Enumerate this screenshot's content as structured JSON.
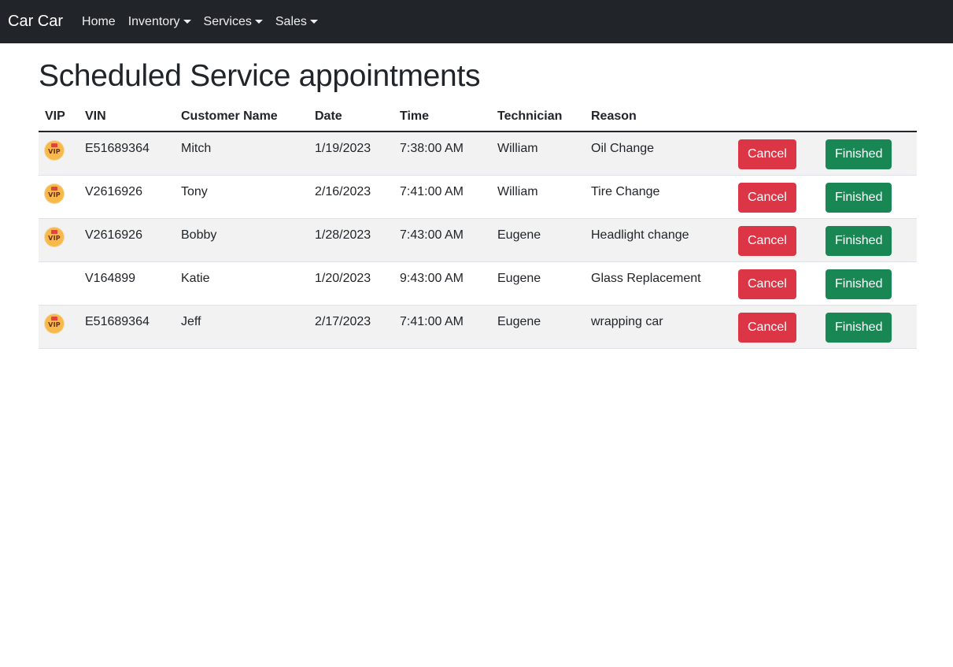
{
  "navbar": {
    "brand": "Car Car",
    "links": [
      {
        "label": "Home",
        "dropdown": false
      },
      {
        "label": "Inventory",
        "dropdown": true
      },
      {
        "label": "Services",
        "dropdown": true
      },
      {
        "label": "Sales",
        "dropdown": true
      }
    ]
  },
  "page": {
    "title": "Scheduled Service appointments"
  },
  "table": {
    "headers": [
      "VIP",
      "VIN",
      "Customer Name",
      "Date",
      "Time",
      "Technician",
      "Reason",
      "",
      ""
    ],
    "vip_icon_text": "VIP",
    "cancel_label": "Cancel",
    "finished_label": "Finished",
    "rows": [
      {
        "vip": true,
        "vin": "E51689364",
        "customer": "Mitch",
        "date": "1/19/2023",
        "time": "7:38:00 AM",
        "technician": "William",
        "reason": "Oil Change"
      },
      {
        "vip": true,
        "vin": "V2616926",
        "customer": "Tony",
        "date": "2/16/2023",
        "time": "7:41:00 AM",
        "technician": "William",
        "reason": "Tire Change"
      },
      {
        "vip": true,
        "vin": "V2616926",
        "customer": "Bobby",
        "date": "1/28/2023",
        "time": "7:43:00 AM",
        "technician": "Eugene",
        "reason": "Headlight change"
      },
      {
        "vip": false,
        "vin": "V164899",
        "customer": "Katie",
        "date": "1/20/2023",
        "time": "9:43:00 AM",
        "technician": "Eugene",
        "reason": "Glass Replacement"
      },
      {
        "vip": true,
        "vin": "E51689364",
        "customer": "Jeff",
        "date": "2/17/2023",
        "time": "7:41:00 AM",
        "technician": "Eugene",
        "reason": "wrapping car"
      }
    ]
  },
  "colors": {
    "navbar_bg": "#212529",
    "cancel": "#dc3545",
    "finished": "#198754",
    "stripe": "#f2f2f2"
  }
}
